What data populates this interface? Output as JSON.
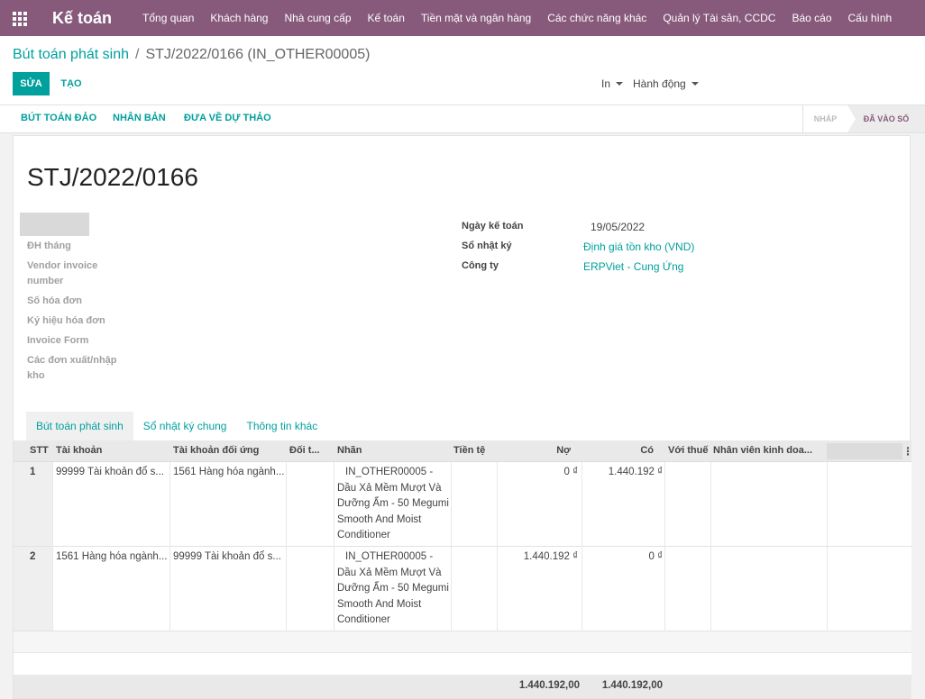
{
  "navbar": {
    "brand": "Kế toán",
    "menu": [
      "Tổng quan",
      "Khách hàng",
      "Nhà cung cấp",
      "Kế toán",
      "Tiền mặt và ngân hàng",
      "Các chức năng khác",
      "Quản lý Tài sản, CCDC",
      "Báo cáo",
      "Cấu hình"
    ]
  },
  "breadcrumb": {
    "parent": "Bút toán phát sinh",
    "separator": "/",
    "current": "STJ/2022/0166 (IN_OTHER00005)"
  },
  "controls": {
    "edit": "SỬA",
    "create": "TẠO",
    "print": "In",
    "action": "Hành động"
  },
  "statusbar": {
    "reverse": "BÚT TOÁN ĐẢO",
    "duplicate": "NHÂN BẢN",
    "reset_draft": "ĐƯA VỀ DỰ THẢO",
    "stage_draft": "NHÁP",
    "stage_posted": "ĐÃ VÀO SỔ"
  },
  "form": {
    "title": "STJ/2022/0166",
    "left_labels": {
      "dh_thang": "ĐH tháng",
      "vendor_invoice_1": "Vendor invoice",
      "vendor_invoice_2": "number",
      "so_hoa_don": "Số hóa đơn",
      "ky_hieu": "Ký hiệu hóa đơn",
      "invoice_form": "Invoice Form",
      "cac_don_1": "Các đơn xuất/nhập",
      "cac_don_2": "kho"
    },
    "right": {
      "ngay_ke_toan_label": "Ngày kế toán",
      "ngay_ke_toan_value": "19/05/2022",
      "so_nhat_ky_label": "Sổ nhật ký",
      "so_nhat_ky_value": "Định giá tồn kho (VND)",
      "cong_ty_label": "Công ty",
      "cong_ty_value": "ERPViet - Cung Ứng"
    }
  },
  "tabs": [
    "Bút toán phát sinh",
    "Sổ nhật ký chung",
    "Thông tin khác"
  ],
  "table": {
    "headers": {
      "stt": "STT",
      "account": "Tài khoản",
      "counter_account": "Tài khoản đối ứng",
      "partner": "Đối t...",
      "label": "Nhãn",
      "currency": "Tiền tệ",
      "debit": "Nợ",
      "credit": "Có",
      "tax": "Với thuế",
      "salesperson": "Nhân viên kinh doa..."
    },
    "rows": [
      {
        "stt": "1",
        "account": "99999 Tài khoản đổ s...",
        "counter_account": "1561 Hàng hóa ngành...",
        "label_lines": [
          "IN_OTHER00005 -",
          "Dầu Xả Mềm Mượt Và",
          "Dưỡng Ẩm - 50 Megumi",
          "Smooth And Moist",
          "Conditioner"
        ],
        "debit": "0 ₫",
        "credit": "1.440.192 ₫"
      },
      {
        "stt": "2",
        "account": "1561 Hàng hóa ngành...",
        "counter_account": "99999 Tài khoản đổ s...",
        "label_lines": [
          "IN_OTHER00005 -",
          "Dầu Xả Mềm Mượt Và",
          "Dưỡng Ẩm - 50 Megumi",
          "Smooth And Moist",
          "Conditioner"
        ],
        "debit": "1.440.192 ₫",
        "credit": "0 ₫"
      }
    ],
    "totals": {
      "debit": "1.440.192,00",
      "credit": "1.440.192,00"
    }
  }
}
